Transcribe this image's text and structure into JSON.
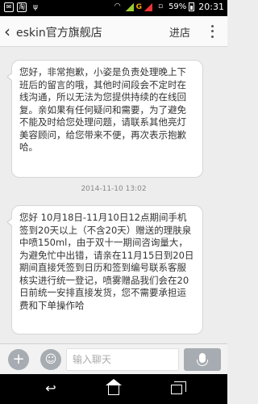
{
  "status_bar": {
    "battery": "59%",
    "time": "20:31",
    "network_badge": "G"
  },
  "header": {
    "back_icon": "chevron-left-icon",
    "title": "eskin官方旗舰店",
    "enter_store_label": "进店",
    "menu_icon": "more-vertical-icon"
  },
  "messages": [
    {
      "text": "您好，非常抱歉，小姿是负责处理晚上下班后的留言的哦，其他时间段会不定时在线沟通，所以无法为您提供持续的在线回复。亲如果有任何疑问和需要，为了避免不能及时给您处理问题，请联系其他亮灯美容顾问，给您带来不便，再次表示抱歉哈。"
    },
    {
      "timestamp": "2014-11-10 13:02",
      "text": "您好 10月18日-11月10日12点期间手机签到20天以上（不含20天）赠送的理肤泉中喷150ml，由于双十一期间咨询量大，为避免忙中出错，请亲在11月15日到20日期间直接凭签到日历和签到编号联系客服核实进行统一登记，喷雾赠品我们会在20日前统一安排直接发货，您不需要承担运费和下单操作哈"
    }
  ],
  "input_bar": {
    "add_icon": "plus-icon",
    "emoji_icon": "emoji-icon",
    "placeholder": "输入聊天",
    "voice_icon": "microphone-icon"
  },
  "nav_bar": {
    "back_icon": "back-icon",
    "home_icon": "home-icon",
    "recent_icon": "recent-apps-icon"
  }
}
